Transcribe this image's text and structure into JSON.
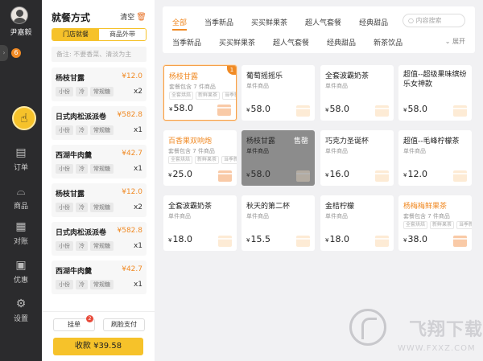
{
  "nav": {
    "username": "尹嘉毅",
    "badge_count": "6",
    "items": [
      {
        "label": "订单",
        "icon": "orders-icon"
      },
      {
        "label": "商品",
        "icon": "cloche-icon"
      },
      {
        "label": "对账",
        "icon": "reconcile-icon"
      },
      {
        "label": "优惠",
        "icon": "wallet-icon"
      },
      {
        "label": "设置",
        "icon": "gear-icon"
      }
    ]
  },
  "order": {
    "title": "就餐方式",
    "clear_label": "清空",
    "dine_options": [
      "门店就餐",
      "商品外带"
    ],
    "selected_dine_option": "门店就餐",
    "note_placeholder": "备注: 不要香菜、清淡为主",
    "items": [
      {
        "name": "杨枝甘露",
        "price": "¥12.0",
        "tags": [
          "小份",
          "冷",
          "常规糖"
        ],
        "qty": "x2"
      },
      {
        "name": "日式肉松派派卷",
        "price": "¥582.8",
        "tags": [
          "小份",
          "冷",
          "常规糖"
        ],
        "qty": "x1"
      },
      {
        "name": "西湖牛肉羹",
        "price": "¥42.7",
        "tags": [
          "小份",
          "冷",
          "常规糖"
        ],
        "qty": "x1"
      },
      {
        "name": "杨枝甘露",
        "price": "¥12.0",
        "tags": [
          "小份",
          "冷",
          "常规糖"
        ],
        "qty": "x2"
      },
      {
        "name": "日式肉松派派卷",
        "price": "¥582.8",
        "tags": [
          "小份",
          "冷",
          "常规糖"
        ],
        "qty": "x1"
      },
      {
        "name": "西湖牛肉羹",
        "price": "¥42.7",
        "tags": [
          "小份",
          "冷",
          "常规糖"
        ],
        "qty": "x1"
      }
    ],
    "hold_label": "挂单",
    "hold_count": "2",
    "face_pay_label": "刷脸支付",
    "pay_label": "收款 ¥39.58"
  },
  "filter": {
    "row1": [
      "全部",
      "当季新品",
      "买买鲜果茶",
      "超人气套餐",
      "经典甜品"
    ],
    "active": "全部",
    "row2": [
      "当季新品",
      "买买鲜果茶",
      "超人气套餐",
      "经典甜品",
      "新茶饮品"
    ],
    "search_placeholder": "内容搜索",
    "expand_label": "展开"
  },
  "products": [
    {
      "name": "杨枝甘露",
      "type": "套餐包含 7 件商品",
      "tags": [
        "全套烘焙",
        "新鲜果茶",
        "当季新品"
      ],
      "price": "58.0",
      "state": "selected",
      "corner": "1"
    },
    {
      "name": "葡萄摇摇乐",
      "type": "单件商品",
      "tags": [],
      "price": "58.0",
      "state": "normal"
    },
    {
      "name": "全套波霸奶茶",
      "type": "单件商品",
      "tags": [],
      "price": "58.0",
      "state": "normal"
    },
    {
      "name": "超值--超级果味缤纷乐女神款",
      "type": "",
      "tags": [],
      "price": "58.0",
      "state": "normal"
    },
    {
      "name": "百香果双响炮",
      "type": "套餐包含 7 件商品",
      "tags": [
        "全套烘焙",
        "新鲜果茶",
        "当季新品"
      ],
      "price": "25.0",
      "state": "combo"
    },
    {
      "name": "杨枝甘露",
      "type": "单件商品",
      "tags": [],
      "price": "58.0",
      "state": "soldout",
      "soldout_label": "售罄"
    },
    {
      "name": "巧克力圣诞杯",
      "type": "单件商品",
      "tags": [],
      "price": "16.0",
      "state": "normal"
    },
    {
      "name": "超值--毛峰柠檬茶",
      "type": "单件商品",
      "tags": [],
      "price": "12.0",
      "state": "normal"
    },
    {
      "name": "全套波霸奶茶",
      "type": "单件商品",
      "tags": [],
      "price": "18.0",
      "state": "normal"
    },
    {
      "name": "秋天的第二杯",
      "type": "单件商品",
      "tags": [],
      "price": "15.5",
      "state": "normal"
    },
    {
      "name": "金桔柠檬",
      "type": "单件商品",
      "tags": [],
      "price": "18.0",
      "state": "normal"
    },
    {
      "name": "杨梅梅鲜果茶",
      "type": "套餐包含 7 件商品",
      "tags": [
        "全套烘焙",
        "新鲜果茶",
        "当季新品"
      ],
      "price": "38.0",
      "state": "combo"
    }
  ],
  "watermark": {
    "title": "飞翔下载",
    "url": "WWW.FXXZ.COM"
  }
}
